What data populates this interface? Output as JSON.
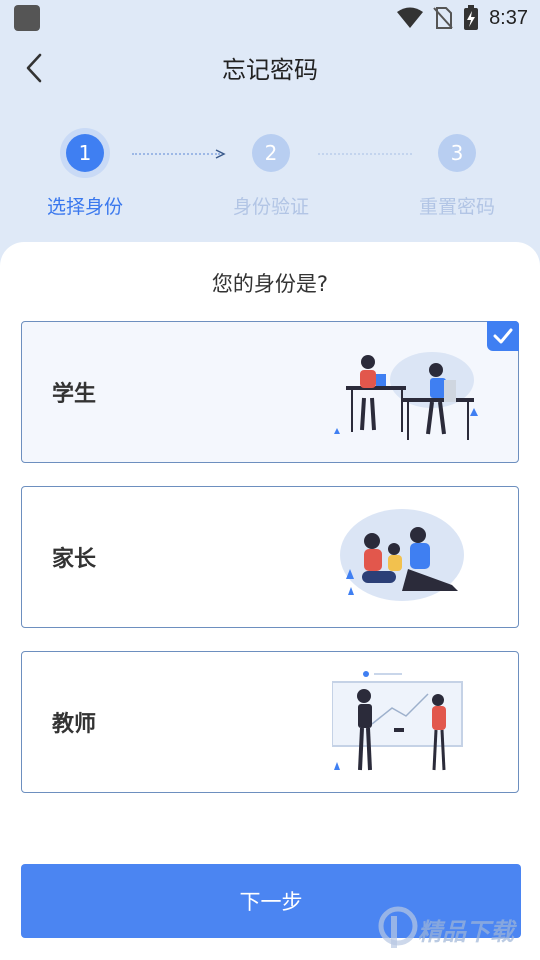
{
  "status_bar": {
    "time": "8:37"
  },
  "header": {
    "title": "忘记密码"
  },
  "steps": [
    {
      "number": "1",
      "label": "选择身份"
    },
    {
      "number": "2",
      "label": "身份验证"
    },
    {
      "number": "3",
      "label": "重置密码"
    }
  ],
  "question": "您的身份是?",
  "options": [
    {
      "label": "学生",
      "selected": true,
      "icon": "student-illustration"
    },
    {
      "label": "家长",
      "selected": false,
      "icon": "parent-illustration"
    },
    {
      "label": "教师",
      "selected": false,
      "icon": "teacher-illustration"
    }
  ],
  "next_button": {
    "label": "下一步"
  },
  "watermark": {
    "text": "精品下载"
  },
  "colors": {
    "accent": "#3f7ff2",
    "header_bg": "#dfe9f7",
    "button": "#4b85f2"
  }
}
